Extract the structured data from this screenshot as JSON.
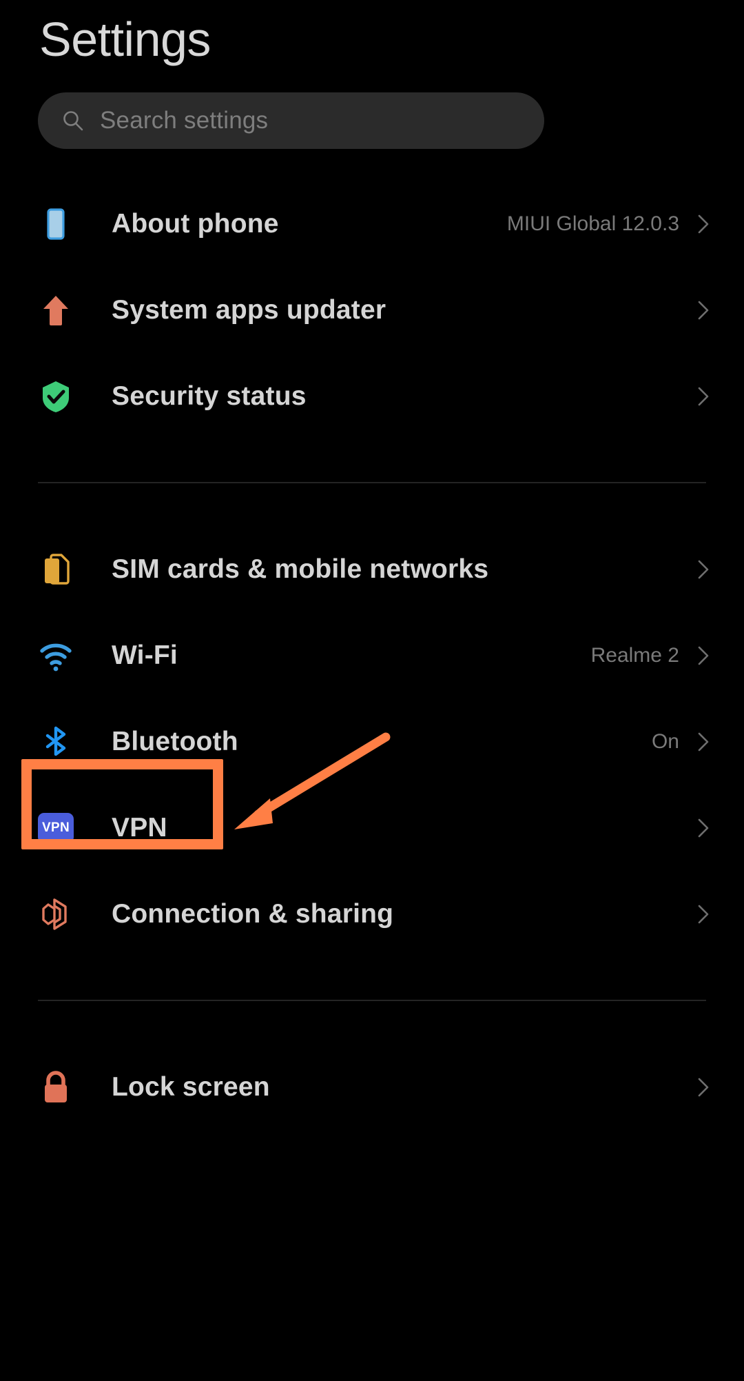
{
  "header": {
    "title": "Settings"
  },
  "search": {
    "placeholder": "Search settings",
    "icon": "search-icon",
    "value": ""
  },
  "groups": [
    {
      "id": "device-group",
      "items": [
        {
          "label": "About phone",
          "value": "MIUI Global 12.0.3",
          "icon": "phone-icon",
          "icon_color": "#8ec4e8",
          "chevron": "chevron-right-icon",
          "highlighted": false
        },
        {
          "label": "System apps updater",
          "value": "",
          "icon": "arrow-up-icon",
          "icon_color": "#e07a5f",
          "chevron": "chevron-right-icon",
          "highlighted": false
        },
        {
          "label": "Security status",
          "value": "",
          "icon": "shield-check-icon",
          "icon_color": "#3ecc78",
          "chevron": "chevron-right-icon",
          "highlighted": false
        }
      ]
    },
    {
      "id": "connectivity-group",
      "items": [
        {
          "label": "SIM cards & mobile networks",
          "value": "",
          "icon": "sim-card-icon",
          "icon_color": "#e0a63a",
          "chevron": "chevron-right-icon",
          "highlighted": false
        },
        {
          "label": "Wi-Fi",
          "value": "Realme 2",
          "icon": "wifi-icon",
          "icon_color": "#3d9de0",
          "chevron": "chevron-right-icon",
          "highlighted": false
        },
        {
          "label": "Bluetooth",
          "value": "On",
          "icon": "bluetooth-icon",
          "icon_color": "#2196f3",
          "chevron": "chevron-right-icon",
          "highlighted": false
        },
        {
          "label": "VPN",
          "value": "",
          "icon": "vpn-badge-icon",
          "icon_color": "#4a5ddb",
          "icon_text": "VPN",
          "chevron": "chevron-right-icon",
          "highlighted": true
        },
        {
          "label": "Connection & sharing",
          "value": "",
          "icon": "connection-sharing-icon",
          "icon_color": "#e07a5f",
          "chevron": "chevron-right-icon",
          "highlighted": false
        }
      ]
    },
    {
      "id": "personal-group",
      "items": [
        {
          "label": "Lock screen",
          "value": "",
          "icon": "lock-icon",
          "icon_color": "#e07358",
          "chevron": "chevron-right-icon",
          "highlighted": false
        }
      ]
    }
  ],
  "annotation": {
    "highlight_color": "#ff7f45",
    "arrow_color": "#ff7f45",
    "target_label": "VPN"
  },
  "colors": {
    "background": "#000000",
    "search_field": "#2b2b2b",
    "primary_text": "#d5d5d5",
    "secondary_text": "#7a7a7a",
    "divider": "#242424"
  }
}
